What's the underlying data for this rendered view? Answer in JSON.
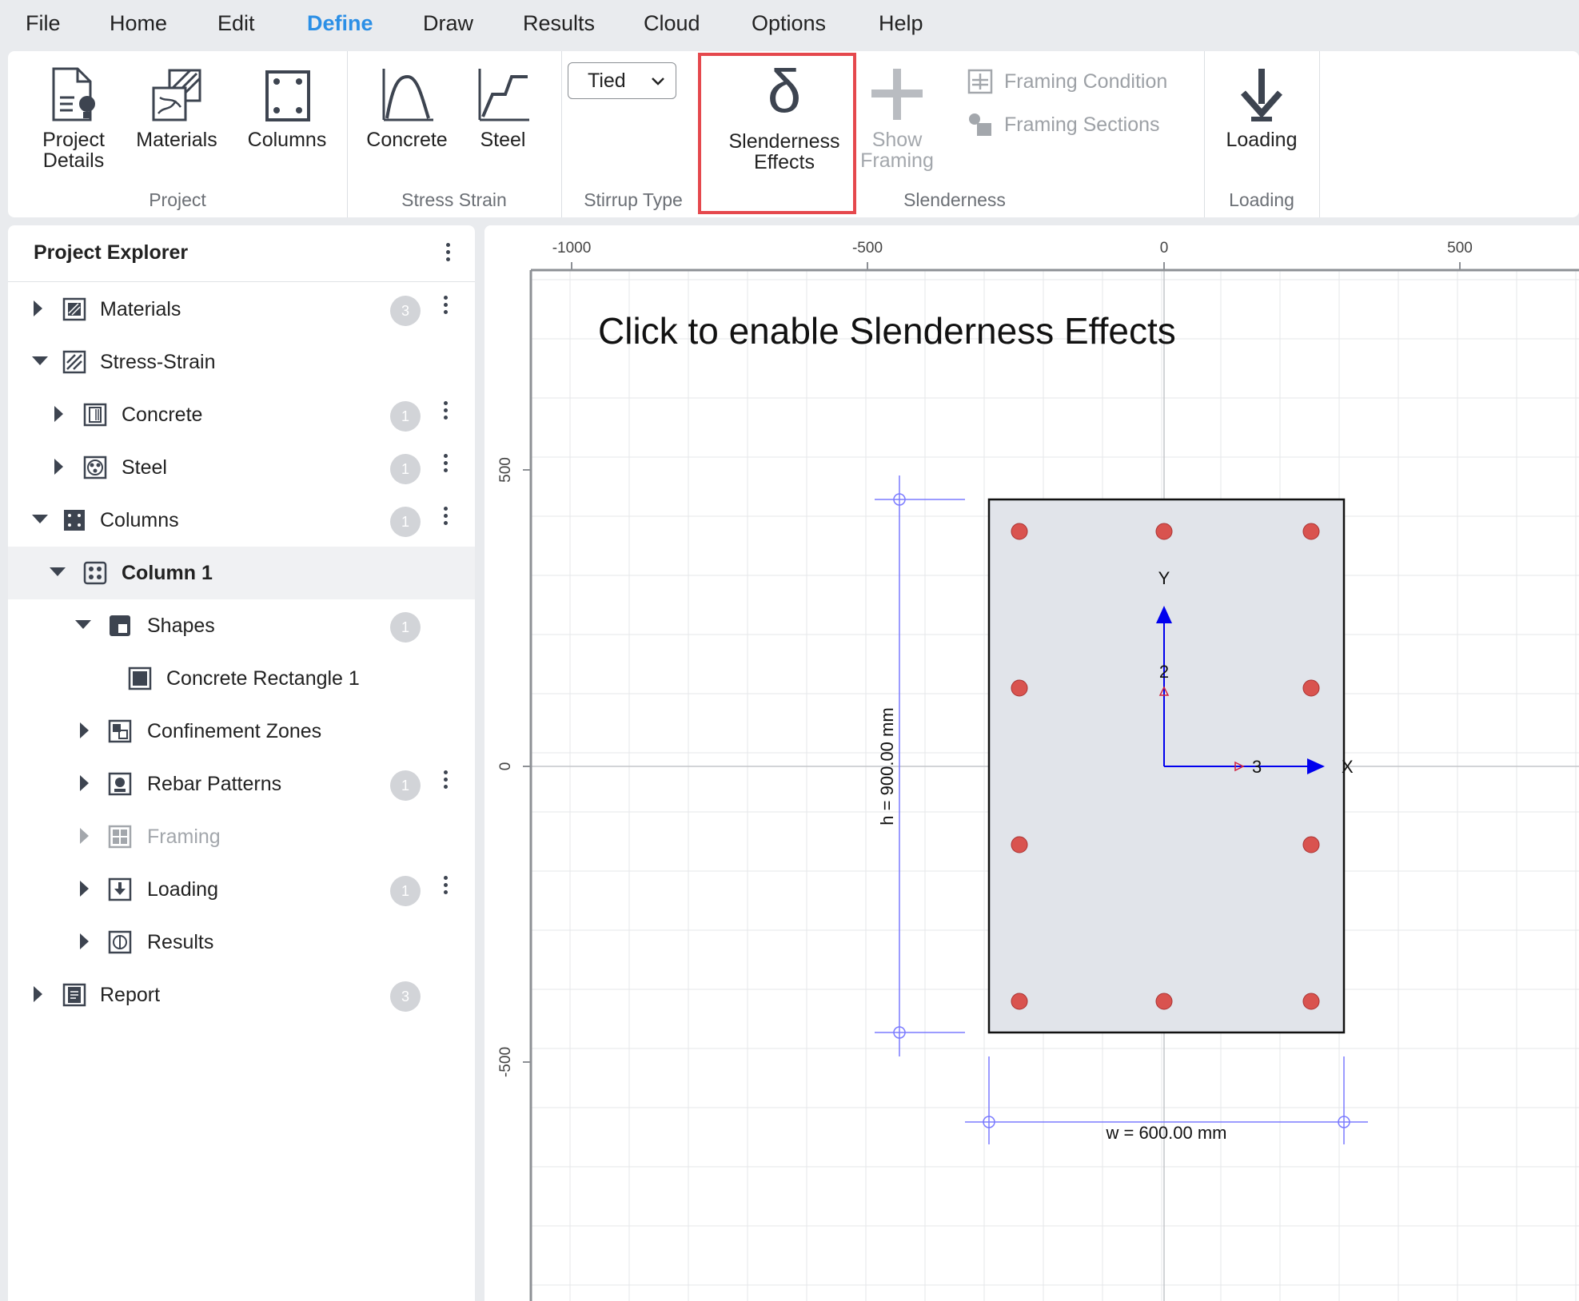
{
  "menu": [
    "File",
    "Home",
    "Edit",
    "Define",
    "Draw",
    "Results",
    "Cloud",
    "Options",
    "Help"
  ],
  "ribbon": {
    "project_details": "Project Details",
    "materials": "Materials",
    "columns": "Columns",
    "group_project": "Project",
    "concrete": "Concrete",
    "steel": "Steel",
    "group_stress_strain": "Stress Strain",
    "stirrup_value": "Tied",
    "group_stirrup": "Stirrup Type",
    "slenderness_effects": "Slenderness Effects",
    "show_framing": "Show Framing",
    "framing_condition": "Framing Condition",
    "framing_sections": "Framing Sections",
    "group_slenderness": "Slenderness",
    "loading": "Loading",
    "group_loading": "Loading"
  },
  "explorer": {
    "title": "Project Explorer",
    "items": [
      {
        "label": "Materials",
        "badge": "3"
      },
      {
        "label": "Stress-Strain"
      },
      {
        "label": "Concrete",
        "badge": "1"
      },
      {
        "label": "Steel",
        "badge": "1"
      },
      {
        "label": "Columns",
        "badge": "1"
      },
      {
        "label": "Column 1"
      },
      {
        "label": "Shapes",
        "badge": "1"
      },
      {
        "label": "Concrete Rectangle 1"
      },
      {
        "label": "Confinement Zones"
      },
      {
        "label": "Rebar Patterns",
        "badge": "1"
      },
      {
        "label": "Framing"
      },
      {
        "label": "Loading",
        "badge": "1"
      },
      {
        "label": "Results"
      },
      {
        "label": "Report",
        "badge": "3"
      }
    ]
  },
  "canvas": {
    "message": "Click to enable Slenderness Effects",
    "x_ticks": [
      "-1000",
      "-500",
      "0",
      "500"
    ],
    "y_ticks": [
      "500",
      "0",
      "-500"
    ],
    "height_dim": "h = 900.00 mm",
    "width_dim": "w = 600.00 mm",
    "axis_x": "X",
    "axis_y": "Y",
    "axis_2": "2",
    "axis_3": "3"
  },
  "colors": {
    "accent": "#2b8fe6",
    "highlight": "#e5484d",
    "rebar": "#d9534f",
    "section_fill": "#e1e4ea",
    "axis_blue": "#0000ee",
    "dim_line": "#7b7bff"
  }
}
